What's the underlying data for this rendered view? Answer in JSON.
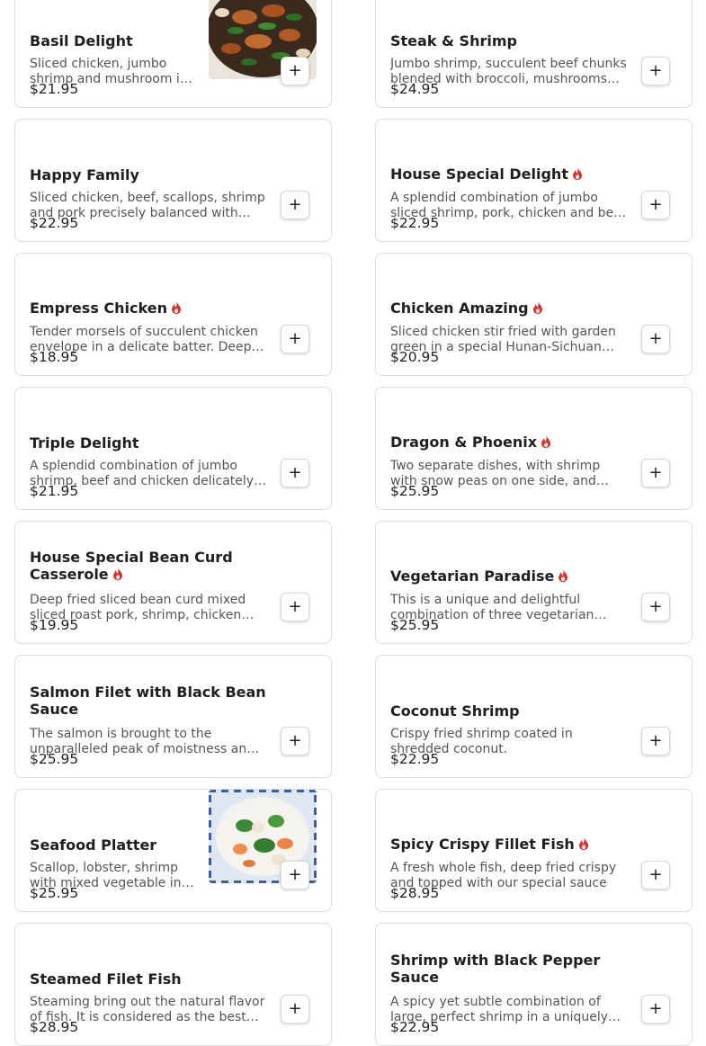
{
  "add_symbol": "+",
  "items": [
    {
      "name": "Basil Delight",
      "spicy": false,
      "desc": "Sliced chicken, jumbo shrimp and mushroom in basil sauce",
      "price": "$21.95",
      "image": "stir-fried-chicken-shrimp-basil"
    },
    {
      "name": "Steak & Shrimp",
      "spicy": false,
      "desc": "Jumbo shrimp, succulent beef chunks blended with broccoli, mushrooms and baby corn",
      "price": "$24.95"
    },
    {
      "name": "Happy Family",
      "spicy": false,
      "desc": "Sliced chicken, beef, scallops, shrimp and pork precisely balanced with mixed vegetables",
      "price": "$22.95"
    },
    {
      "name": "House Special Delight",
      "spicy": true,
      "desc": "A splendid combination of jumbo sliced shrimp, pork, chicken and beef stir fried",
      "price": "$22.95"
    },
    {
      "name": "Empress Chicken",
      "spicy": true,
      "desc": "Tender morsels of succulent chicken envelope in a delicate batter. Deep fried",
      "price": "$18.95"
    },
    {
      "name": "Chicken Amazing",
      "spicy": true,
      "desc": "Sliced chicken stir fried with garden green in a special Hunan-Sichuan sauce",
      "price": "$20.95"
    },
    {
      "name": "Triple Delight",
      "spicy": false,
      "desc": "A splendid combination of jumbo shrimp, beef and chicken delicately sauteed",
      "price": "$21.95"
    },
    {
      "name": "Dragon & Phoenix",
      "spicy": true,
      "desc": "Two separate dishes, with shrimp with snow peas on one side, and chicken",
      "price": "$25.95"
    },
    {
      "name": "House Special Bean Curd Casserole",
      "spicy": true,
      "desc": "Deep fried sliced bean curd mixed sliced roast pork, shrimp, chicken and vegetables",
      "price": "$19.95"
    },
    {
      "name": "Vegetarian Paradise",
      "spicy": true,
      "desc": "This is a unique and delightful combination of three vegetarian dishes",
      "price": "$25.95"
    },
    {
      "name": "Salmon Filet with Black Bean Sauce",
      "spicy": false,
      "desc": "The salmon is brought to the unparalleled peak of moistness and flavor",
      "price": "$25.95"
    },
    {
      "name": "Coconut Shrimp",
      "spicy": false,
      "desc": "Crispy fried shrimp coated in shredded coconut.",
      "price": "$22.95"
    },
    {
      "name": "Seafood Platter",
      "spicy": false,
      "desc": "Scallop, lobster, shrimp with mixed vegetable in white sauce",
      "price": "$25.95",
      "image": "seafood-vegetable-platter"
    },
    {
      "name": "Spicy Crispy Fillet Fish",
      "spicy": true,
      "desc": "A fresh whole fish, deep fried crispy and topped with our special sauce",
      "price": "$28.95"
    },
    {
      "name": "Steamed Filet Fish",
      "spicy": false,
      "desc": "Steaming bring out the natural flavor of fish. It is considered as the best method",
      "price": "$28.95"
    },
    {
      "name": "Shrimp with Black Pepper Sauce",
      "spicy": false,
      "desc": "A spicy yet subtle combination of large, perfect shrimp in a uniquely flavored sauce",
      "price": "$22.95"
    }
  ],
  "colors": {
    "accent_spicy": "#d9342b",
    "border": "#dcdcdc"
  },
  "icons": {
    "spicy": "flame-icon",
    "add": "plus-icon"
  }
}
